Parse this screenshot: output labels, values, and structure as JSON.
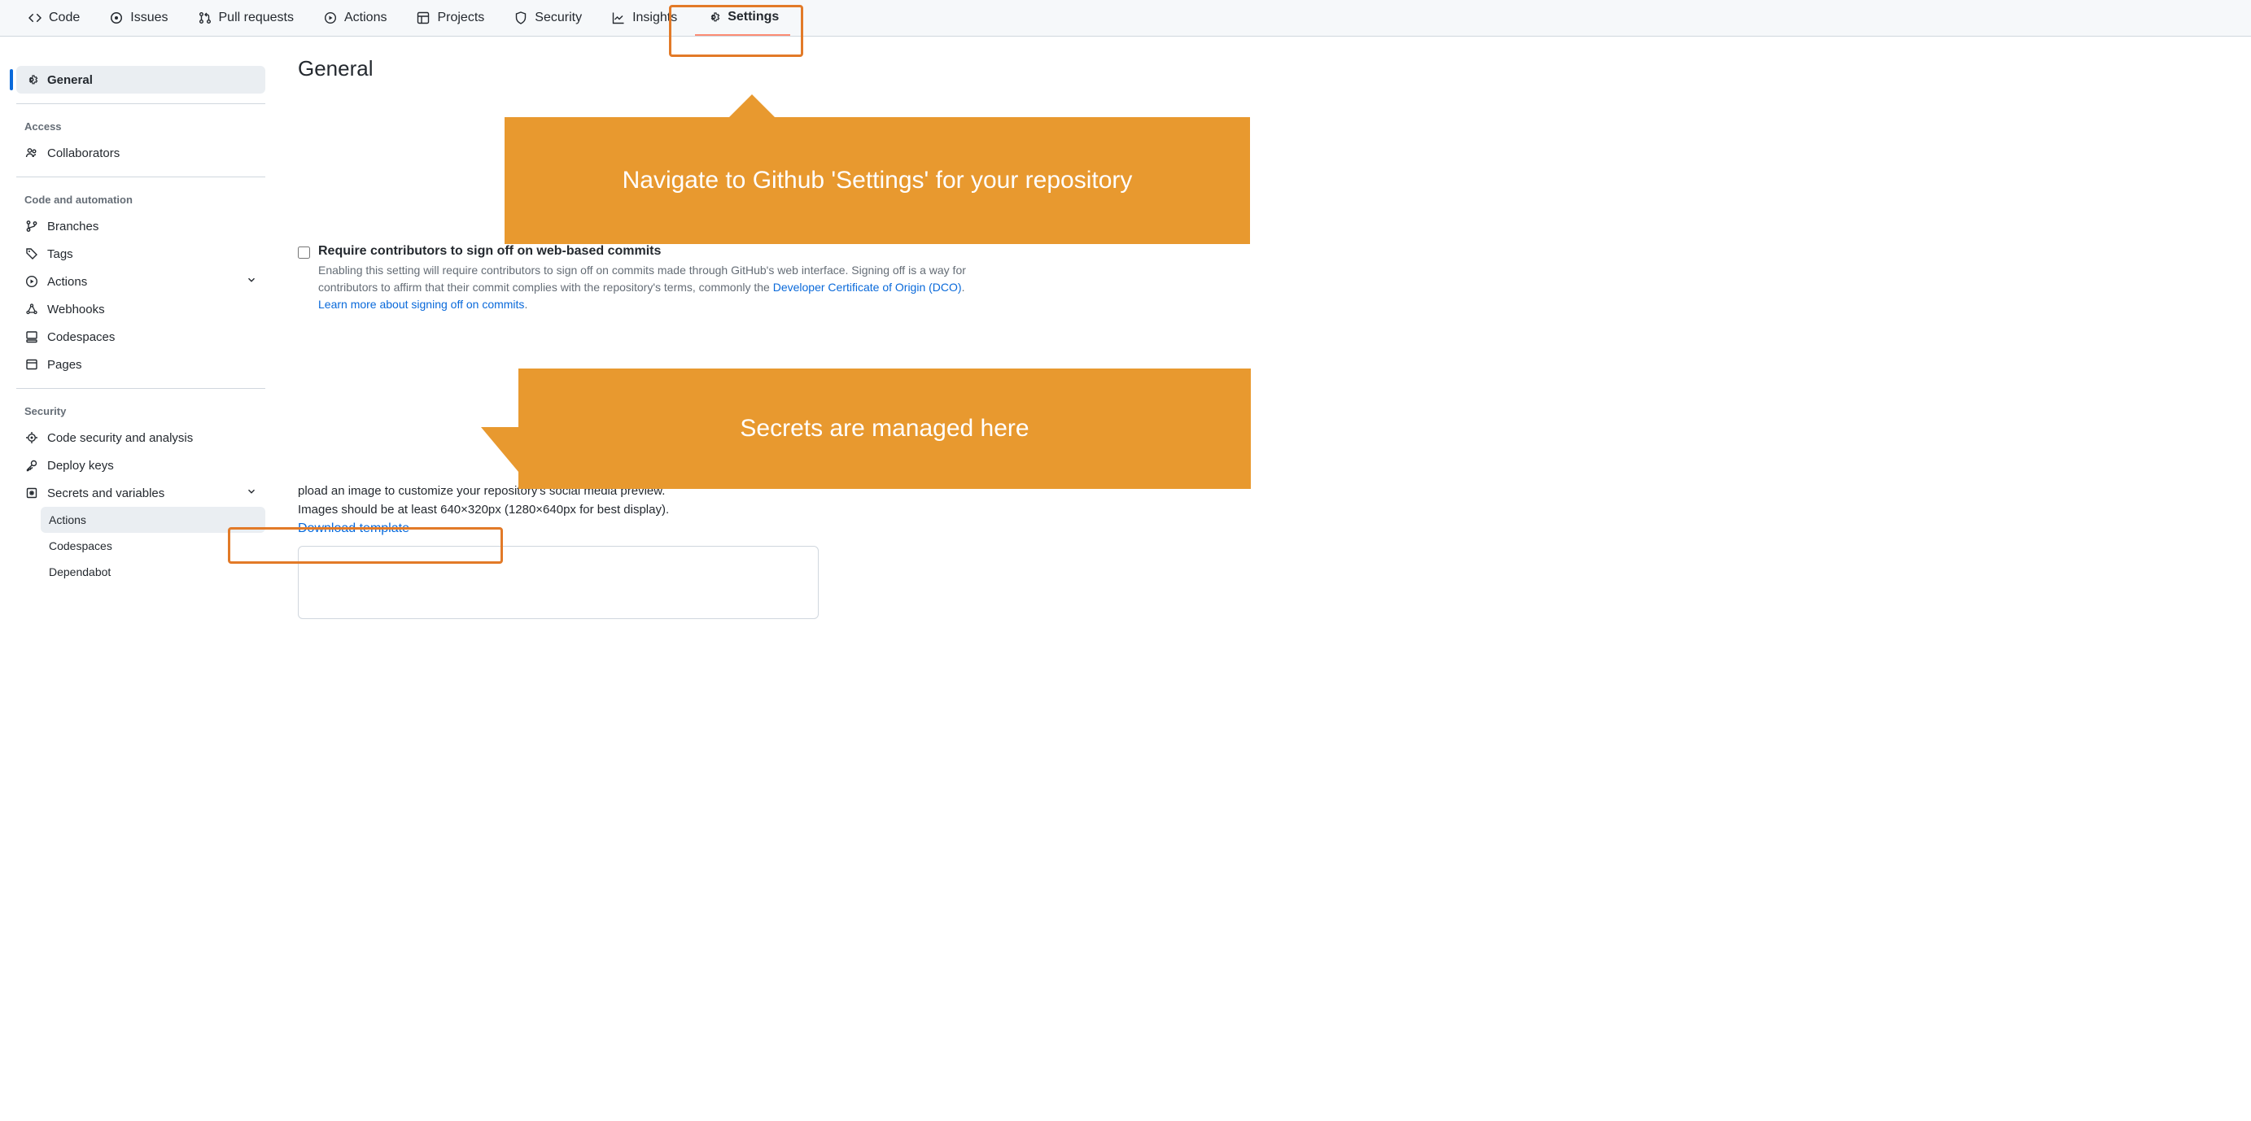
{
  "topnav": [
    {
      "label": "Code",
      "icon": "code"
    },
    {
      "label": "Issues",
      "icon": "issue"
    },
    {
      "label": "Pull requests",
      "icon": "pr"
    },
    {
      "label": "Actions",
      "icon": "play"
    },
    {
      "label": "Projects",
      "icon": "table"
    },
    {
      "label": "Security",
      "icon": "shield"
    },
    {
      "label": "Insights",
      "icon": "graph"
    },
    {
      "label": "Settings",
      "icon": "gear",
      "active": true
    }
  ],
  "sidebar": {
    "general": "General",
    "groups": [
      {
        "title": "Access",
        "items": [
          {
            "label": "Collaborators",
            "icon": "people"
          }
        ]
      },
      {
        "title": "Code and automation",
        "items": [
          {
            "label": "Branches",
            "icon": "branch"
          },
          {
            "label": "Tags",
            "icon": "tag"
          },
          {
            "label": "Actions",
            "icon": "playcircle",
            "expandable": true
          },
          {
            "label": "Webhooks",
            "icon": "webhook"
          },
          {
            "label": "Codespaces",
            "icon": "codespace"
          },
          {
            "label": "Pages",
            "icon": "browser"
          }
        ]
      },
      {
        "title": "Security",
        "items": [
          {
            "label": "Code security and analysis",
            "icon": "scan"
          },
          {
            "label": "Deploy keys",
            "icon": "key"
          },
          {
            "label": "Secrets and variables",
            "icon": "secret",
            "expandable": true,
            "subitems": [
              {
                "label": "Actions",
                "highlighted": true
              },
              {
                "label": "Codespaces"
              },
              {
                "label": "Dependabot"
              }
            ]
          }
        ]
      }
    ]
  },
  "content": {
    "title": "General",
    "signoff": {
      "label": "Require contributors to sign off on web-based commits",
      "desc1": "Enabling this setting will require contributors to sign off on commits made through GitHub's web interface. Signing off is a way for contributors to affirm that their commit complies with the repository's terms, commonly the ",
      "link1": "Developer Certificate of Origin (DCO)",
      "desc2": ". ",
      "link2": "Learn more about signing off on commits",
      "desc3": "."
    },
    "social": {
      "line1": "pload an image to customize your repository's social media preview.",
      "line2": "Images should be at least 640×320px (1280×640px for best display).",
      "link": "Download template"
    }
  },
  "annotations": {
    "callout1": "Navigate to Github 'Settings' for your repository",
    "callout2": "Secrets are managed here"
  }
}
